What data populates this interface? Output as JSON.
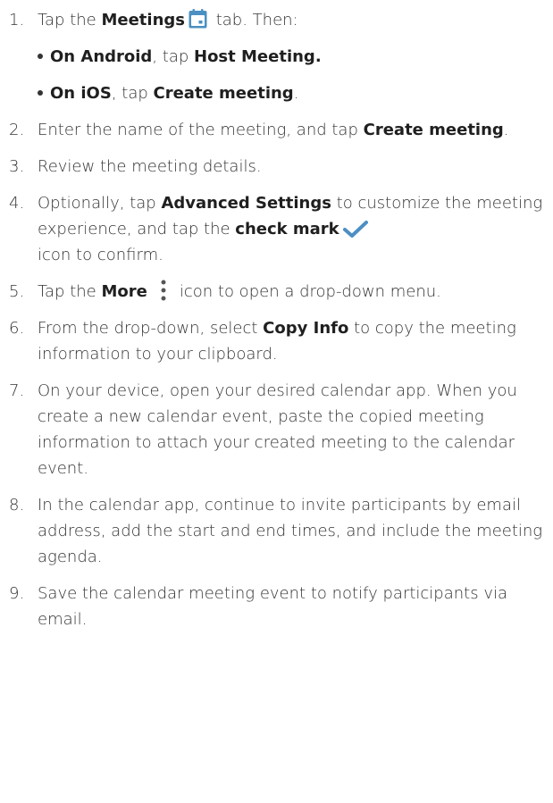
{
  "steps": [
    {
      "num": "1.",
      "parts": [
        "Tap the ",
        "Meetings",
        " tab. Then:"
      ],
      "sub": [
        {
          "parts": [
            "On Android",
            ", tap ",
            "Host Meeting."
          ]
        },
        {
          "parts": [
            "On iOS",
            ", tap ",
            "Create meeting",
            "."
          ]
        }
      ]
    },
    {
      "num": "2.",
      "parts": [
        "Enter the name of the meeting, and tap ",
        "Create meeting",
        "."
      ]
    },
    {
      "num": "3.",
      "parts": [
        "Review the meeting details."
      ]
    },
    {
      "num": "4.",
      "parts": [
        "Optionally, tap ",
        "Advanced Settings",
        " to customize the meeting experience, and tap the ",
        "check mark",
        "icon to confirm."
      ]
    },
    {
      "num": "5.",
      "parts": [
        "Tap the ",
        "More",
        "icon to open a drop-down menu."
      ]
    },
    {
      "num": "6.",
      "parts": [
        "From the drop-down, select ",
        "Copy Info",
        " to copy the meeting information to your clipboard."
      ]
    },
    {
      "num": "7.",
      "parts": [
        "On your device, open your desired calendar app. When you create a new calendar event, paste the copied meeting information to attach your created meeting to the calendar event."
      ]
    },
    {
      "num": "8.",
      "parts": [
        "In the calendar app, continue to invite participants by email address, add the start and end times, and include the meeting agenda."
      ]
    },
    {
      "num": "9.",
      "parts": [
        "Save the calendar meeting event to notify participants via email."
      ]
    }
  ],
  "icons": {
    "meetings": "calendar-icon",
    "check": "check-mark-icon",
    "more": "more-vertical-icon"
  },
  "colors": {
    "text": "#333333",
    "calendar_icon": "#4a90c2",
    "check_icon": "#4d8fc4"
  }
}
